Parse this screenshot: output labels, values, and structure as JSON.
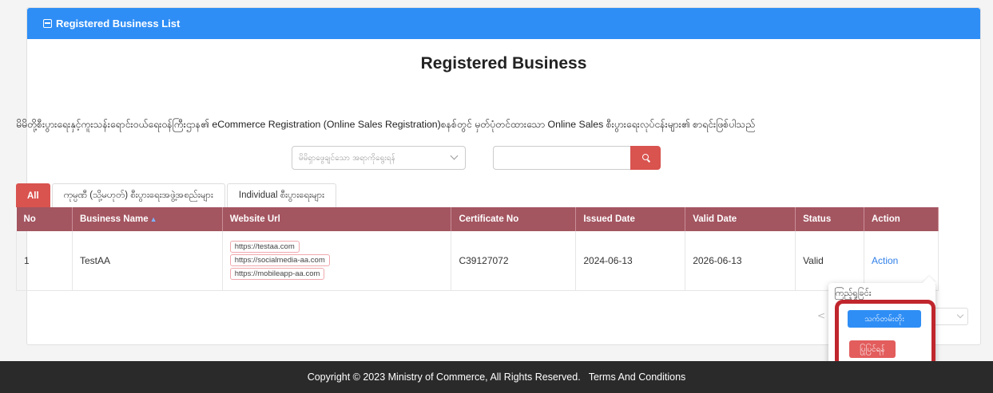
{
  "header": {
    "title": "Registered Business List",
    "icon": "list-icon"
  },
  "page": {
    "title": "Registered Business",
    "description": "မိမိတို့စီးပွားရေးနှင့်ကူးသန်းရောင်းဝယ်ရေးဝန်ကြီးဌာန၏ eCommerce Registration (Online Sales Registration)စနစ်တွင် မှတ်ပုံတင်ထားသော Online Sales စီးပွားရေးလုပ်ငန်းများ၏ စာရင်းဖြစ်ပါသည်"
  },
  "filters": {
    "select_placeholder": "မိမိရှာဖွေချင်သော အရာကိုရွေးရန်",
    "search_value": ""
  },
  "tabs": [
    {
      "label": "All",
      "active": true
    },
    {
      "label": "ကုမ္ပဏီ (သို့မဟုတ်) စီးပွားရေးအဖွဲ့အစည်းများ"
    },
    {
      "label": "Individual စီးပွားရေးများ"
    }
  ],
  "table": {
    "headers": {
      "no": "No",
      "business_name": "Business Name",
      "website": "Website Url",
      "certificate": "Certificate No",
      "issued": "Issued Date",
      "valid": "Valid Date",
      "status": "Status",
      "action": "Action"
    },
    "rows": [
      {
        "no": "1",
        "business_name": "TestAA",
        "urls": [
          "https://testaa.com",
          "https://socialmedia-aa.com",
          "https://mobileapp-aa.com"
        ],
        "certificate": "C39127072",
        "issued": "2024-06-13",
        "valid": "2026-06-13",
        "status": "Valid",
        "action": "Action"
      }
    ]
  },
  "dropdown": {
    "view_label": "ကြည့်ရှုခြင်း",
    "suspend_label": "သက်တမ်းတိုး",
    "edit_label": "ပြုပြင်ရန်"
  },
  "pager": {
    "prev": "<"
  },
  "footer": {
    "copyright": "Copyright © 2023 Ministry of Commerce, All Rights Reserved.",
    "terms": "Terms And Conditions"
  },
  "colors": {
    "header_blue": "#2f8ef5",
    "table_header": "#a35560",
    "tab_active": "#d9534f",
    "highlight": "#c0262d",
    "footer_bg": "#2a2a2a"
  }
}
